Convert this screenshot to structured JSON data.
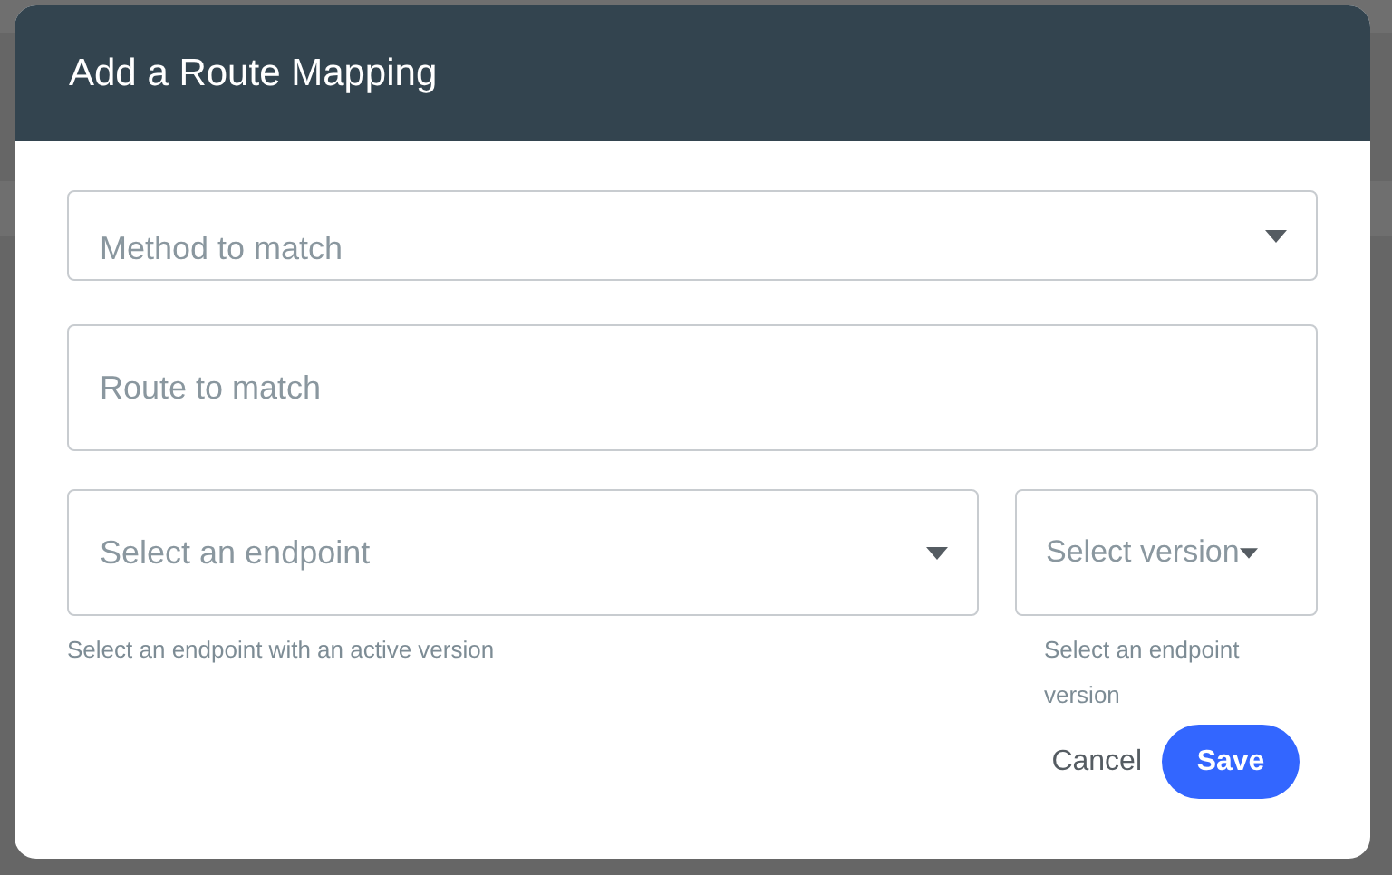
{
  "dialog": {
    "title": "Add a Route Mapping",
    "fields": [
      {
        "kind": "select",
        "placeholder": "Method to match"
      },
      {
        "kind": "input",
        "placeholder": "Route to match"
      }
    ],
    "endpoint": {
      "placeholder": "Select an endpoint",
      "help": "Select an endpoint with an active version"
    },
    "version": {
      "placeholder": "Select version",
      "help": "Select an endpoint version"
    },
    "buttons": [
      {
        "kind": "text",
        "label": "Cancel"
      },
      {
        "kind": "primary",
        "label": "Save"
      }
    ]
  }
}
